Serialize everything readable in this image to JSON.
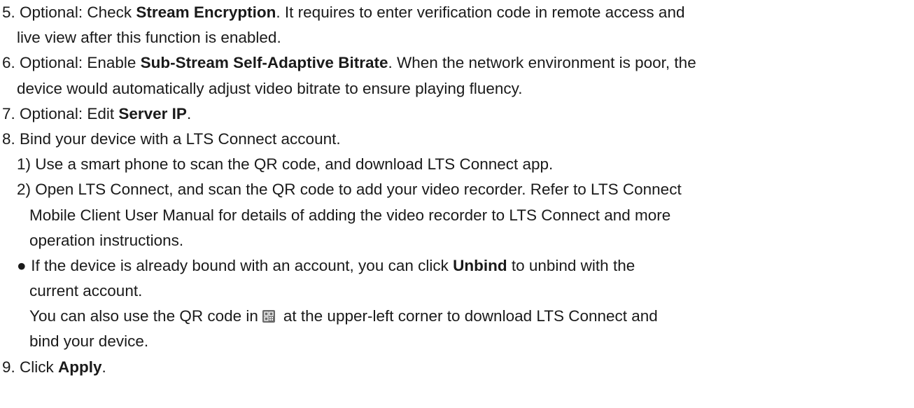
{
  "steps": {
    "s5": {
      "num": "5.",
      "a": " Optional: Check ",
      "b": "Stream Encryption",
      "c": ". It requires to enter verification code in remote access and",
      "d": "live view after this function is enabled."
    },
    "s6": {
      "num": "6.",
      "a": " Optional: Enable ",
      "b": "Sub-Stream Self-Adaptive Bitrate",
      "c": ". When the network environment is poor, the",
      "d": "device would automatically adjust video bitrate to ensure playing fluency."
    },
    "s7": {
      "num": "7.",
      "a": " Optional: Edit ",
      "b": "Server IP",
      "c": "."
    },
    "s8": {
      "num": "8.",
      "a": " Bind your device with a LTS Connect account."
    },
    "s8_1": {
      "text": "1) Use a smart phone to scan the QR code, and download LTS Connect app."
    },
    "s8_2": {
      "line1": "2) Open LTS Connect, and scan the QR code to add your video recorder. Refer to LTS Connect",
      "line2": "Mobile Client User Manual for details of adding the video recorder to LTS Connect and more",
      "line3": "operation instructions."
    },
    "bullet": {
      "glyph": "●",
      "a": "If the device is already bound with an account, you can click ",
      "b": "Unbind",
      "c": " to unbind with the",
      "d": "current account.",
      "e": "You can also use the QR code in",
      "f": "at the upper-left corner to download LTS Connect and",
      "g": "bind your device.",
      "icon": "qr-code-icon"
    },
    "s9": {
      "num": "9.",
      "a": " Click ",
      "b": "Apply",
      "c": "."
    }
  }
}
